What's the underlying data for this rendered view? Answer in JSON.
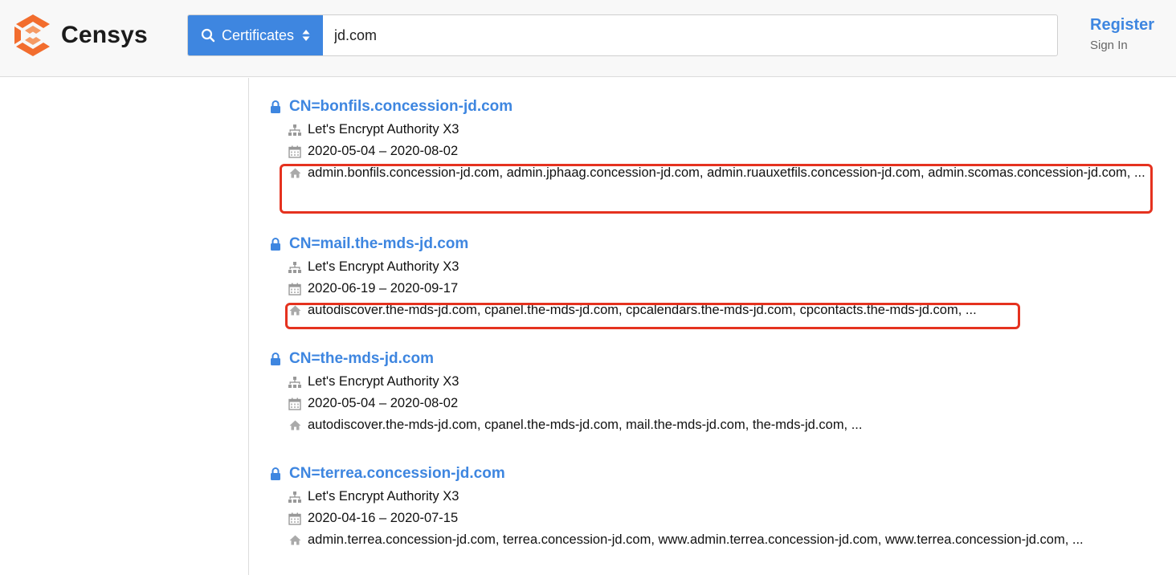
{
  "brand": {
    "name": "Censys",
    "logo_color": "#f26d2e"
  },
  "search": {
    "type_label": "Certificates",
    "query": "jd.com"
  },
  "account": {
    "register_label": "Register",
    "signin_label": "Sign In"
  },
  "colors": {
    "accent": "#3e86e0",
    "highlight": "#e5321f"
  },
  "results": [
    {
      "title": "CN=bonfils.concession-jd.com",
      "issuer": "Let's Encrypt Authority X3",
      "validity": "2020-05-04 – 2020-08-02",
      "names": "admin.bonfils.concession-jd.com, admin.jphaag.concession-jd.com, admin.ruauxetfils.concession-jd.com, admin.scomas.concession-jd.com, ...",
      "highlighted": true
    },
    {
      "title": "CN=mail.the-mds-jd.com",
      "issuer": "Let's Encrypt Authority X3",
      "validity": "2020-06-19 – 2020-09-17",
      "names": "autodiscover.the-mds-jd.com, cpanel.the-mds-jd.com, cpcalendars.the-mds-jd.com, cpcontacts.the-mds-jd.com, ...",
      "highlighted": true
    },
    {
      "title": "CN=the-mds-jd.com",
      "issuer": "Let's Encrypt Authority X3",
      "validity": "2020-05-04 – 2020-08-02",
      "names": "autodiscover.the-mds-jd.com, cpanel.the-mds-jd.com, mail.the-mds-jd.com, the-mds-jd.com, ...",
      "highlighted": false
    },
    {
      "title": "CN=terrea.concession-jd.com",
      "issuer": "Let's Encrypt Authority X3",
      "validity": "2020-04-16 – 2020-07-15",
      "names": "admin.terrea.concession-jd.com, terrea.concession-jd.com, www.admin.terrea.concession-jd.com, www.terrea.concession-jd.com, ...",
      "highlighted": false
    }
  ]
}
